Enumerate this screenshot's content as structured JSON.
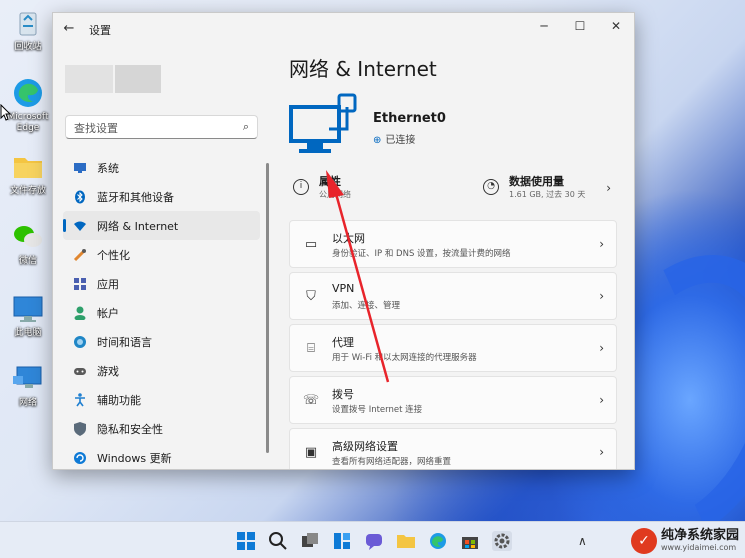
{
  "desktop": {
    "icons": [
      {
        "label": "回收站",
        "icon": "recycle-bin-icon"
      },
      {
        "label": "Microsoft Edge",
        "icon": "edge-icon"
      },
      {
        "label": "文件存放",
        "icon": "folder-icon"
      },
      {
        "label": "微信",
        "icon": "wechat-icon"
      },
      {
        "label": "此电脑",
        "icon": "computer-icon"
      },
      {
        "label": "网络",
        "icon": "network-icon"
      }
    ]
  },
  "window": {
    "title": "设置",
    "controls": {
      "minimize": "─",
      "maximize": "☐",
      "close": "✕"
    }
  },
  "sidebar": {
    "search_placeholder": "查找设置",
    "items": [
      {
        "label": "系统",
        "icon": "system-icon",
        "color": "#2b6cc4"
      },
      {
        "label": "蓝牙和其他设备",
        "icon": "bluetooth-icon",
        "color": "#0067c0"
      },
      {
        "label": "网络 & Internet",
        "icon": "wifi-icon",
        "color": "#0067c0",
        "active": true
      },
      {
        "label": "个性化",
        "icon": "brush-icon",
        "color": "#e0862f"
      },
      {
        "label": "应用",
        "icon": "apps-icon",
        "color": "#4a5fb0"
      },
      {
        "label": "帐户",
        "icon": "account-icon",
        "color": "#2ea06b"
      },
      {
        "label": "时间和语言",
        "icon": "time-language-icon",
        "color": "#1f86c6"
      },
      {
        "label": "游戏",
        "icon": "gaming-icon",
        "color": "#5a5a5a"
      },
      {
        "label": "辅助功能",
        "icon": "accessibility-icon",
        "color": "#1f7fd0"
      },
      {
        "label": "隐私和安全性",
        "icon": "shield-icon",
        "color": "#5a6a7a"
      },
      {
        "label": "Windows 更新",
        "icon": "update-icon",
        "color": "#0e7ad6"
      }
    ]
  },
  "main": {
    "page_title": "网络 & Internet",
    "adapter": {
      "name": "Ethernet0",
      "status": "已连接"
    },
    "properties": {
      "title": "属性",
      "subtitle": "公用网络"
    },
    "data_usage": {
      "title": "数据使用量",
      "subtitle": "1.61 GB, 过去 30 天"
    },
    "cards": [
      {
        "title": "以太网",
        "subtitle": "身份验证、IP 和 DNS 设置，按流量计费的网络",
        "icon": "ethernet-icon"
      },
      {
        "title": "VPN",
        "subtitle": "添加、连接、管理",
        "icon": "vpn-shield-icon"
      },
      {
        "title": "代理",
        "subtitle": "用于 Wi-Fi 和以太网连接的代理服务器",
        "icon": "proxy-icon"
      },
      {
        "title": "拨号",
        "subtitle": "设置拨号 Internet 连接",
        "icon": "dialup-icon"
      },
      {
        "title": "高级网络设置",
        "subtitle": "查看所有网络适配器，网络重置",
        "icon": "advanced-network-icon"
      }
    ],
    "accent_color": "#0067c0"
  },
  "taskbar": {
    "watermark_title": "纯净系统家园",
    "watermark_url": "www.yidaimei.com"
  }
}
